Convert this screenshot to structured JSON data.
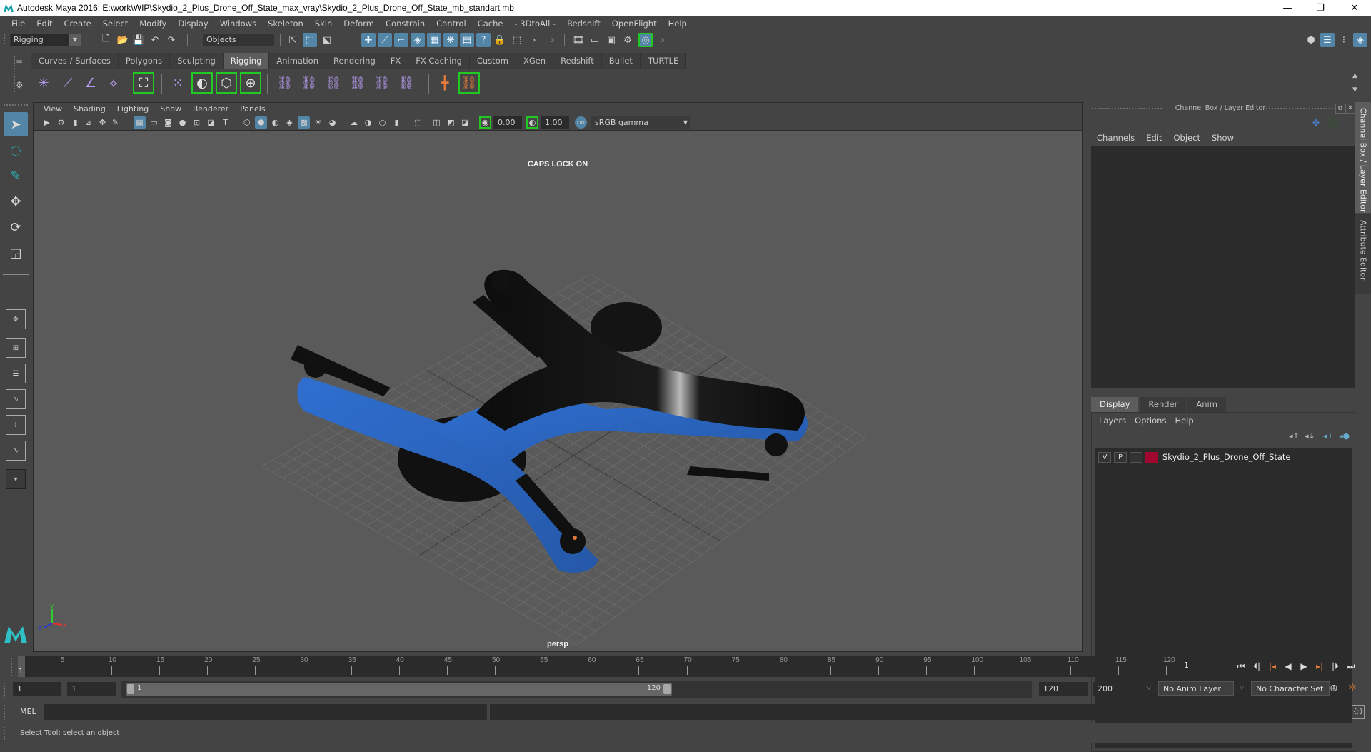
{
  "window": {
    "title": "Autodesk Maya 2016: E:\\work\\WIP\\Skydio_2_Plus_Drone_Off_State_max_vray\\Skydio_2_Plus_Drone_Off_State_mb_standart.mb",
    "minimize": "—",
    "restore": "❐",
    "close": "✕"
  },
  "menubar": [
    "File",
    "Edit",
    "Create",
    "Select",
    "Modify",
    "Display",
    "Windows",
    "Skeleton",
    "Skin",
    "Deform",
    "Constrain",
    "Control",
    "Cache",
    "- 3DtoAll -",
    "Redshift",
    "OpenFlight",
    "Help"
  ],
  "statusline": {
    "menuset": "Rigging",
    "selection_mode": "Objects"
  },
  "shelf": {
    "tabs": [
      "Curves / Surfaces",
      "Polygons",
      "Sculpting",
      "Rigging",
      "Animation",
      "Rendering",
      "FX",
      "FX Caching",
      "Custom",
      "XGen",
      "Redshift",
      "Bullet",
      "TURTLE"
    ],
    "active_tab": "Rigging"
  },
  "viewport": {
    "menu": [
      "View",
      "Shading",
      "Lighting",
      "Show",
      "Renderer",
      "Panels"
    ],
    "exposure": "0.00",
    "gamma": "1.00",
    "color_space": "sRGB gamma",
    "hud_message": "CAPS LOCK ON",
    "camera": "persp",
    "axis": {
      "x": "x",
      "y": "y",
      "z": "z"
    },
    "model_colors": {
      "body_blue": "#2f6fd0",
      "body_black": "#111111",
      "accent_orange": "#e07a3a"
    }
  },
  "channel_box": {
    "title": "Channel Box / Layer Editor",
    "menu": [
      "Channels",
      "Edit",
      "Object",
      "Show"
    ]
  },
  "layer_editor": {
    "tabs": [
      "Display",
      "Render",
      "Anim"
    ],
    "active_tab": "Display",
    "menu": [
      "Layers",
      "Options",
      "Help"
    ],
    "layers": [
      {
        "visible": "V",
        "playback": "P",
        "color": "#a0082f",
        "name": "Skydio_2_Plus_Drone_Off_State"
      }
    ]
  },
  "side_tabs": [
    "Channel Box / Layer Editor",
    "Attribute Editor"
  ],
  "timeline": {
    "ticks": [
      5,
      10,
      15,
      20,
      25,
      30,
      35,
      40,
      45,
      50,
      55,
      60,
      65,
      70,
      75,
      80,
      85,
      90,
      95,
      100,
      105,
      110,
      115,
      120
    ],
    "start": 1,
    "end": 120,
    "current_frame_label": "1",
    "current_frame_field": "1"
  },
  "range": {
    "start_field": "1",
    "playback_start_field": "1",
    "range_start_label": "1",
    "range_end_label": "120",
    "playback_end_field": "120",
    "end_field": "200",
    "anim_layer": "No Anim Layer",
    "character_set": "No Character Set"
  },
  "commandline": {
    "label": "MEL"
  },
  "helpline": {
    "text": "Select Tool: select an object"
  }
}
